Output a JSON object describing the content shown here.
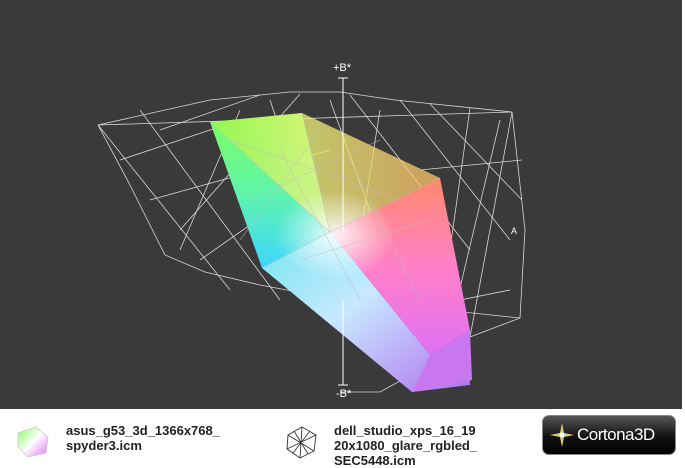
{
  "viewport": {
    "background": "#3a3a3a",
    "axis_top_label": "+B*",
    "axis_bottom_label": "-B*",
    "axis_right_label": "A"
  },
  "legend": {
    "items": [
      {
        "label": "asus_g53_3d_1366x768_\nspyder3.icm",
        "icon": "colored-gamut-icon"
      },
      {
        "label": "dell_studio_xps_16_19\n20x1080_glare_rgbled_\nSEC5448.icm",
        "icon": "wireframe-gamut-icon"
      }
    ]
  },
  "logo": {
    "text": "Cortona3D",
    "icon": "cortona-star-icon"
  }
}
